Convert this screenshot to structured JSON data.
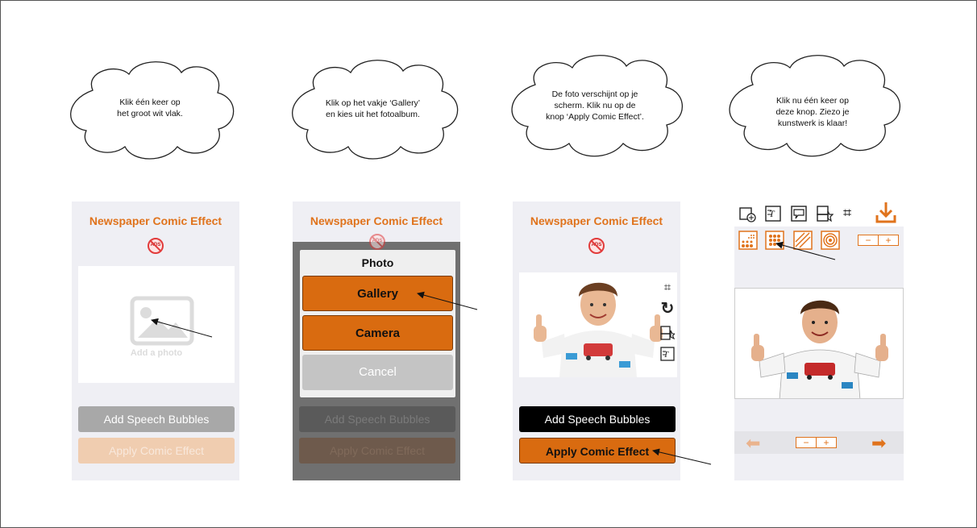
{
  "clouds": [
    {
      "line1": "Klik één keer op",
      "line2": "het groot wit vlak.",
      "line3": ""
    },
    {
      "line1": "Klik op het vakje ‘Gallery’",
      "line2": "en kies uit het fotoalbum.",
      "line3": ""
    },
    {
      "line1": "De foto verschijnt op je",
      "line2": "scherm. Klik nu op de",
      "line3": "knop ‘Apply Comic Effect’."
    },
    {
      "line1": "Klik nu één keer op",
      "line2": "deze knop. Ziezo je",
      "line3": "kunstwerk is klaar!"
    }
  ],
  "app": {
    "title": "Newspaper Comic Effect",
    "noads_label": "ADS",
    "add_photo": "Add a photo",
    "add_speech_bubbles": "Add Speech Bubbles",
    "apply_comic_effect": "Apply Comic Effect"
  },
  "photo_dialog": {
    "title": "Photo",
    "gallery": "Gallery",
    "camera": "Camera",
    "cancel": "Cancel"
  },
  "editor": {
    "minus": "−",
    "plus": "+"
  },
  "colors": {
    "accent": "#e0731c",
    "background": "#efeff4",
    "cancel_gray": "#c4c4c4"
  }
}
